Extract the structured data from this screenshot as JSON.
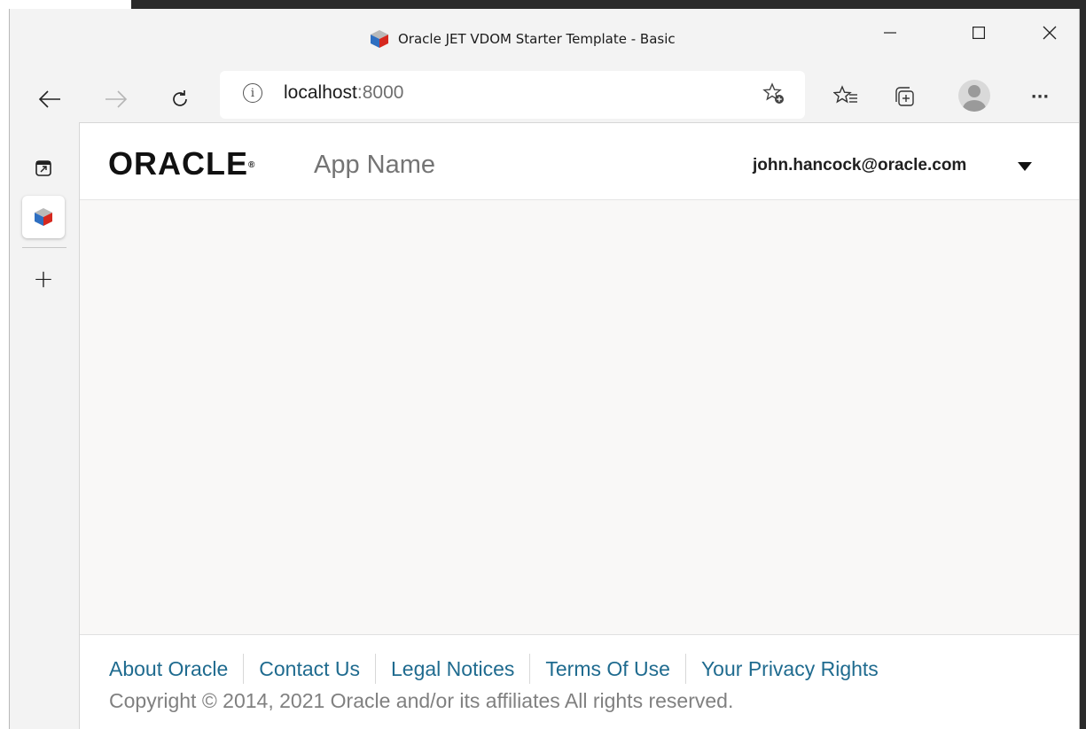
{
  "window": {
    "title": "Oracle JET VDOM Starter Template - Basic",
    "minimize_icon": "minimize-icon",
    "maximize_icon": "maximize-icon",
    "close_icon": "close-icon"
  },
  "toolbar": {
    "back_icon": "back-arrow-icon",
    "forward_icon": "forward-arrow-icon",
    "refresh_icon": "refresh-icon",
    "address": {
      "host": "localhost",
      "port": ":8000"
    },
    "favorites_add_icon": "add-favorite-icon",
    "favorites_icon": "favorites-icon",
    "collections_icon": "collections-icon",
    "profile_icon": "profile-avatar-icon",
    "more_label": "···"
  },
  "vertical_tabs": {
    "actions_icon": "tab-actions-icon",
    "active_tab_icon": "oracle-jet-favicon",
    "new_tab_label": "+"
  },
  "app": {
    "logo_text": "ORACLE",
    "logo_mark": "®",
    "app_name": "App Name",
    "user": "john.hancock@oracle.com",
    "footer_links": [
      "About Oracle",
      "Contact Us",
      "Legal Notices",
      "Terms Of Use",
      "Your Privacy Rights"
    ],
    "copyright": "Copyright © 2014, 2021 Oracle and/or its affiliates All rights reserved."
  },
  "colors": {
    "link": "#1f6b8f",
    "app_name": "#747474",
    "content_bg": "#f9f8f7"
  }
}
